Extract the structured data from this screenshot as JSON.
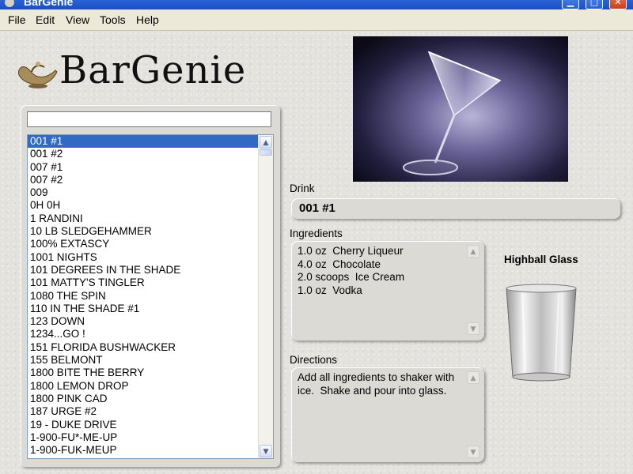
{
  "window": {
    "title": "BarGenie",
    "controls": [
      "minimize",
      "maximize",
      "close"
    ]
  },
  "menu": [
    "File",
    "Edit",
    "View",
    "Tools",
    "Help"
  ],
  "logo": {
    "text": "BarGenie",
    "icon": "genie-lamp-icon"
  },
  "search": {
    "value": "",
    "placeholder": ""
  },
  "drinks": {
    "selected": "001 #1",
    "items": [
      "001 #1",
      "001 #2",
      "007 #1",
      "007 #2",
      "009",
      "0H 0H",
      "1 RANDINI",
      "10 LB SLEDGEHAMMER",
      "100% EXTASCY",
      "1001 NIGHTS",
      "101 DEGREES IN THE SHADE",
      "101 MATTY'S TINGLER",
      "1080 THE SPIN",
      "110 IN THE SHADE #1",
      "123 DOWN",
      "1234...GO !",
      "151 FLORIDA BUSHWACKER",
      "155 BELMONT",
      "1800 BITE THE BERRY",
      "1800 LEMON DROP",
      "1800 PINK CAD",
      "187 URGE #2",
      "19 - DUKE DRIVE",
      "1-900-FU*-ME-UP",
      "1-900-FUK-MEUP"
    ]
  },
  "detail": {
    "drink_label": "Drink",
    "drink_name": "001 #1",
    "ingredients_label": "Ingredients",
    "ingredients": [
      "1.0 oz  Cherry Liqueur",
      "4.0 oz  Chocolate",
      "2.0 scoops  Ice Cream",
      "1.0 oz  Vodka"
    ],
    "directions_label": "Directions",
    "directions": [
      "Add all ingredients to shaker with",
      "ice.  Shake and pour into glass."
    ],
    "glass_type": "Highball Glass",
    "photo": "martini-glass-photo",
    "glass_icon": "highball-glass-icon"
  },
  "colors": {
    "titlebar": "#2a63d8",
    "selection": "#316ac5",
    "background": "#e4e2dd"
  }
}
